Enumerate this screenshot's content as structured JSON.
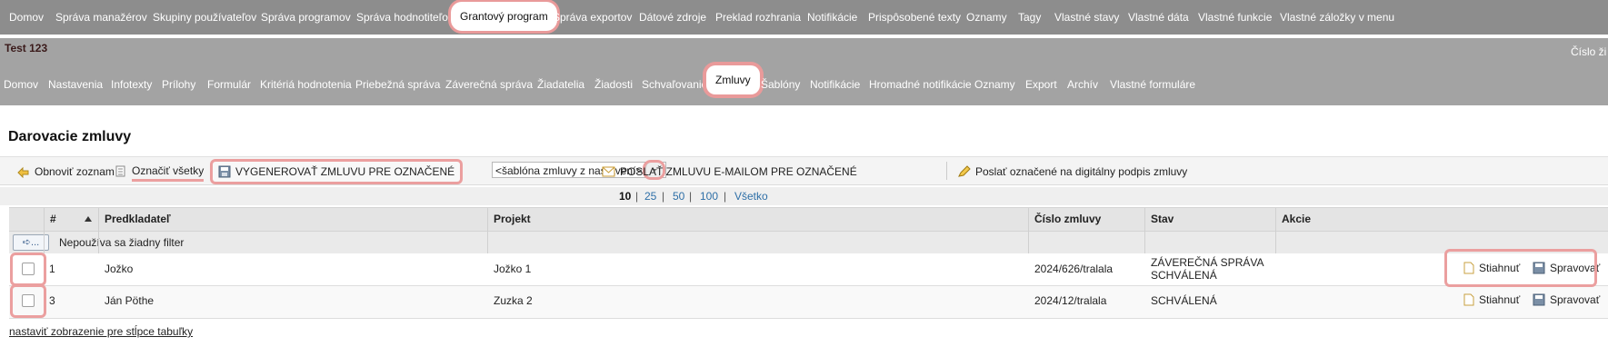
{
  "top_nav": [
    {
      "label": "Domov"
    },
    {
      "label": "Správa manažérov"
    },
    {
      "label": "Skupiny používateľov"
    },
    {
      "label": "Správa programov"
    },
    {
      "label": "Správa hodnotiteľov"
    },
    {
      "label": "Grantový program"
    },
    {
      "label": "Správa exportov"
    },
    {
      "label": "Dátové zdroje"
    },
    {
      "label": "Preklad rozhrania"
    },
    {
      "label": "Notifikácie"
    },
    {
      "label": "Prispôsobené texty"
    },
    {
      "label": "Oznamy"
    },
    {
      "label": "Tagy"
    },
    {
      "label": "Vlastné stavy"
    },
    {
      "label": "Vlastné dáta"
    },
    {
      "label": "Vlastné funkcie"
    },
    {
      "label": "Vlastné záložky v menu"
    }
  ],
  "top_nav_active": "Grantový program",
  "program": {
    "title": "Test 123",
    "right_text": "Číslo ži"
  },
  "sub_nav": [
    {
      "label": "Domov"
    },
    {
      "label": "Nastavenia"
    },
    {
      "label": "Infotexty"
    },
    {
      "label": "Prílohy"
    },
    {
      "label": "Formulár"
    },
    {
      "label": "Kritériá hodnotenia"
    },
    {
      "label": "Priebežná správa"
    },
    {
      "label": "Záverečná správa"
    },
    {
      "label": "Žiadatelia"
    },
    {
      "label": "Žiadosti"
    },
    {
      "label": "Schvaľovanie"
    },
    {
      "label": "Zmluvy"
    },
    {
      "label": "Šablóny"
    },
    {
      "label": "Notifikácie"
    },
    {
      "label": "Hromadné notifikácie"
    },
    {
      "label": "Oznamy"
    },
    {
      "label": "Export"
    },
    {
      "label": "Archív"
    },
    {
      "label": "Vlastné formuláre"
    }
  ],
  "sub_nav_active": "Zmluvy",
  "page_title": "Darovacie zmluvy",
  "toolbar": {
    "refresh": "Obnoviť zoznam",
    "select_all": "Označiť všetky",
    "generate": "VYGENEROVAŤ ZMLUVU PRE OZNAČENÉ",
    "template_select": "<šablóna zmluvy z nastavení>",
    "send_email": "POSLAŤ ZMLUVU E-MAILOM PRE OZNAČENÉ",
    "send_sign": "Poslať označené na digitálny podpis zmluvy"
  },
  "pager": {
    "options": [
      "10",
      "25",
      "50",
      "100",
      "Všetko"
    ],
    "current": "10",
    "separator": "|"
  },
  "table": {
    "headers": {
      "num": "#",
      "applicant": "Predkladateľ",
      "project": "Projekt",
      "contract": "Číslo zmluvy",
      "status": "Stav",
      "actions": "Akcie"
    },
    "filter_button": "...",
    "filter_text": "Nepoužíva sa žiadny filter",
    "rows": [
      {
        "num": "1",
        "applicant": "Jožko",
        "project": "Jožko 1",
        "contract": "2024/626/tralala",
        "status_line1": "ZÁVEREČNÁ SPRÁVA",
        "status_line2": "SCHVÁLENÁ",
        "download": "Stiahnuť",
        "manage": "Spravovať"
      },
      {
        "num": "3",
        "applicant": "Ján Pöthe",
        "project": "Zuzka 2",
        "contract": "2024/12/tralala",
        "status_line1": "SCHVÁLENÁ",
        "status_line2": "",
        "download": "Stiahnuť",
        "manage": "Spravovať"
      }
    ]
  },
  "footer_link": "nastaviť zobrazenie pre stĺpce tabuľky",
  "colors": {
    "nav_bg": "#8d8d8d",
    "program_bg": "#a3a3a3",
    "highlight": "#eb9f9f",
    "link": "#2e6fa7"
  },
  "icons": {
    "refresh": "refresh-icon",
    "select_all": "checklist-icon",
    "generate": "save-icon",
    "dropdown": "chevron-down-icon",
    "email": "envelope-icon",
    "sign": "pen-icon",
    "filter": "filter-icon",
    "download": "document-icon",
    "manage": "save-icon",
    "sort": "sort-asc-icon"
  }
}
